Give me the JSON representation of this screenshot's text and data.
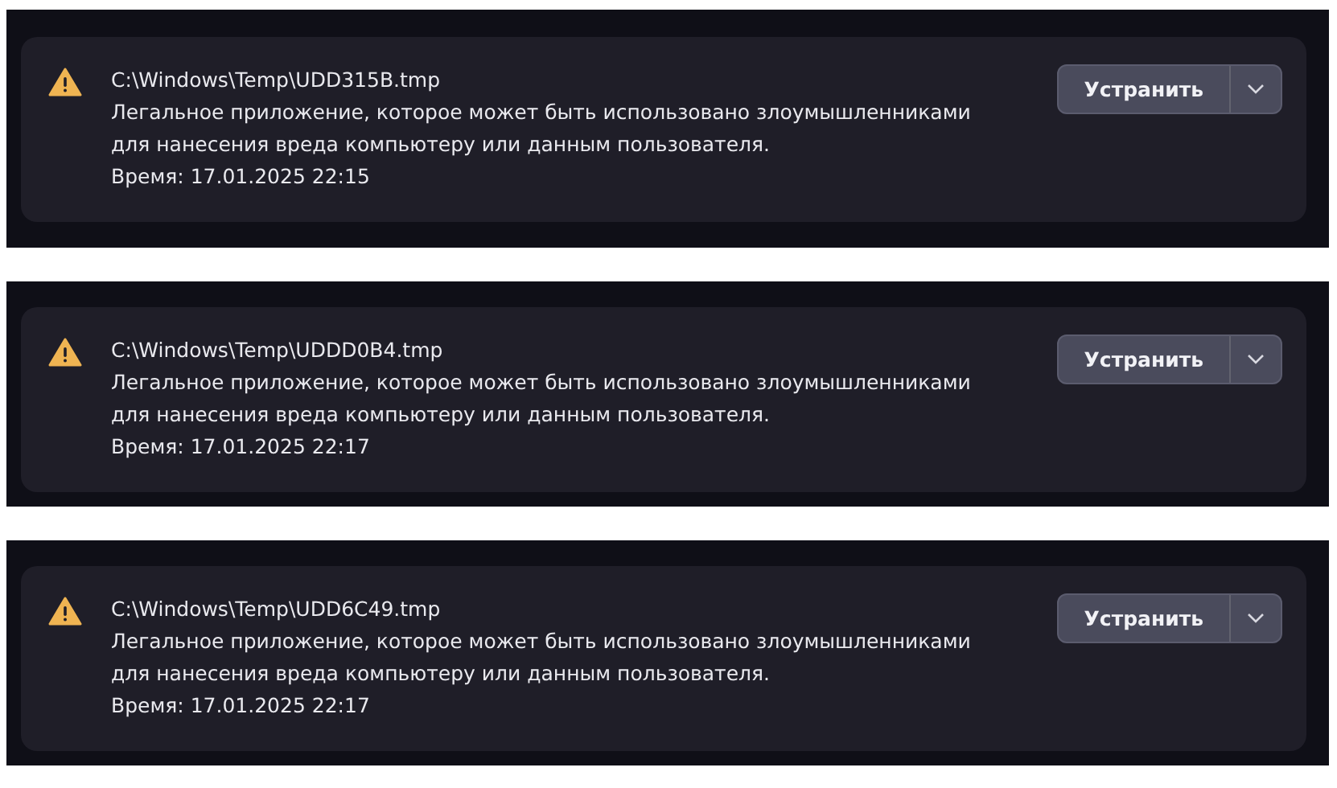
{
  "threats": [
    {
      "path": "C:\\Windows\\Temp\\UDD315B.tmp",
      "description": "Легальное приложение, которое может быть использовано злоумышленниками для нанесения вреда компьютеру или данным пользователя.",
      "time": "Время: 17.01.2025 22:15",
      "action": "Устранить"
    },
    {
      "path": "C:\\Windows\\Temp\\UDDD0B4.tmp",
      "description": "Легальное приложение, которое может быть использовано злоумышленниками для нанесения вреда компьютеру или данным пользователя.",
      "time": "Время: 17.01.2025 22:17",
      "action": "Устранить"
    },
    {
      "path": "C:\\Windows\\Temp\\UDD6C49.tmp",
      "description": "Легальное приложение, которое может быть использовано злоумышленниками для нанесения вреда компьютеру или данным пользователя.",
      "time": "Время: 17.01.2025 22:17",
      "action": "Устранить"
    }
  ]
}
